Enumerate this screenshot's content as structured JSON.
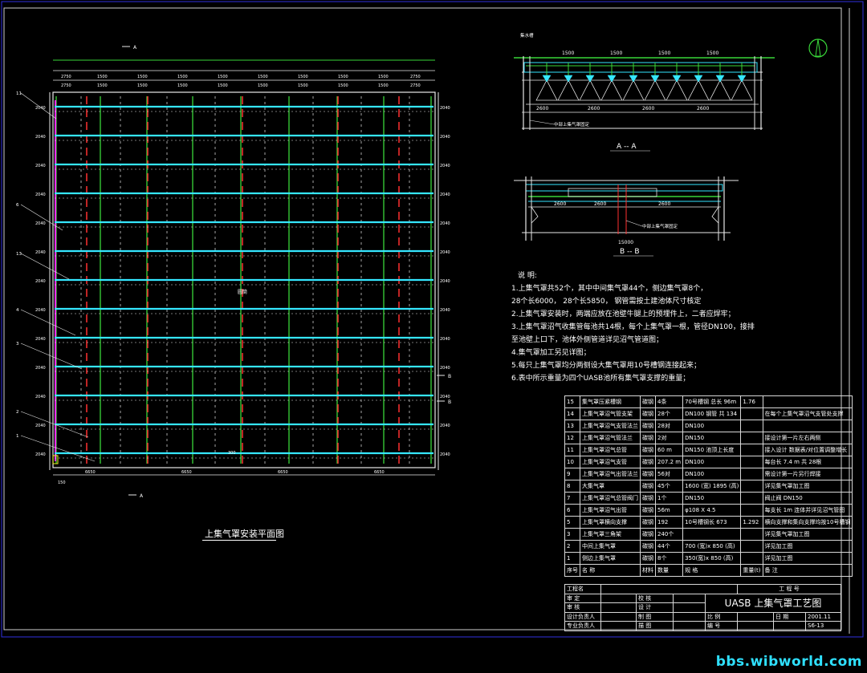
{
  "plan": {
    "title": "上集气罩安装平面图",
    "section_marks": [
      "A",
      "A",
      "B",
      "B"
    ],
    "top_dims": [
      "2750",
      "1500",
      "1500",
      "1500",
      "1500",
      "1500",
      "1500",
      "1500",
      "1500",
      "2750"
    ],
    "side_dims": [
      "2040",
      "2040",
      "2040",
      "2040",
      "2040",
      "2040",
      "2040",
      "2040",
      "2040",
      "2040",
      "2040",
      "2040",
      "2040"
    ],
    "bottom_dims": [
      "6650",
      "6650",
      "6650",
      "6650"
    ],
    "callouts": [
      "11",
      "6",
      "13",
      "4",
      "3",
      "2",
      "1"
    ],
    "label_mid": "圆筒",
    "label_dim": "300",
    "corner_label": "150"
  },
  "section_aa": {
    "title": "A -- A",
    "labels": [
      "集水槽",
      "中部上集气罩固定"
    ]
  },
  "section_bb": {
    "title": "B -- B",
    "labels": [
      "中部上集气罩固定"
    ]
  },
  "notes": {
    "heading": "说    明:",
    "lines": [
      "1.上集气罩共52个，其中中间集气罩44个，侧边集气罩8个，",
      "  28个长6000，  28个长5850，  钢管需按土建池体尺寸核定",
      "2.上集气罩安装时，两端应放在池壁牛腿上的预埋件上，二者应焊牢；",
      "3.上集气罩沼气收集管每池共14根，每个上集气罩一根，管径DN100，接排",
      "  至池壁上口下，池体外侧管道详见沼气管道图；",
      "4.集气罩加工另见详图；",
      "5.每只上集气罩均分两侧设大集气罩用10号槽钢连接起来；",
      "6.表中所示重量为四个UASB池所有集气罩支撑的重量；"
    ]
  },
  "bom": {
    "rows": [
      {
        "no": "15",
        "name": "集气罩压紧槽钢",
        "mat": "碳钢",
        "qty": "4条",
        "spec": "70号槽钢  总长 96m",
        "wt": "1.76",
        "note": ""
      },
      {
        "no": "14",
        "name": "上集气罩沼气管支架",
        "mat": "碳钢",
        "qty": "28个",
        "spec": "DN100 钢管  共 134",
        "wt": "",
        "note": "在每个上集气罩沼气支管处支撑"
      },
      {
        "no": "13",
        "name": "上集气罩沼气支管法兰",
        "mat": "碳钢",
        "qty": "28对",
        "spec": "DN100",
        "wt": "",
        "note": ""
      },
      {
        "no": "12",
        "name": "上集气罩沼气管法兰",
        "mat": "碳钢",
        "qty": "2对",
        "spec": "DN150",
        "wt": "",
        "note": "接设计第一片左右两侧"
      },
      {
        "no": "11",
        "name": "上集气罩沼气总管",
        "mat": "碳钢",
        "qty": "60 m",
        "spec": "DN150 池顶上长度",
        "wt": "",
        "note": "接入设计 数据表/对位置调整增长"
      },
      {
        "no": "10",
        "name": "上集气罩沼气支管",
        "mat": "碳钢",
        "qty": "207.2 m",
        "spec": "DN100",
        "wt": "",
        "note": "每台长 7.4 m 共 28根"
      },
      {
        "no": "9",
        "name": "上集气罩沼气出管法兰",
        "mat": "碳钢",
        "qty": "56对",
        "spec": "DN100",
        "wt": "",
        "note": "需设计第一片另行焊接"
      },
      {
        "no": "8",
        "name": "大集气罩",
        "mat": "碳钢",
        "qty": "45个",
        "spec": "1600 (宽) 1895 (高)",
        "wt": "",
        "note": "详见集气罩加工图"
      },
      {
        "no": "7",
        "name": "上集气罩沼气总管阀门",
        "mat": "碳钢",
        "qty": "1个",
        "spec": "DN150",
        "wt": "",
        "note": "阀止阀 DN150"
      },
      {
        "no": "6",
        "name": "上集气罩沼气出管",
        "mat": "碳钢",
        "qty": "56m",
        "spec": "φ108 X 4.5",
        "wt": "",
        "note": "每支长 1m  连体并详见沼气管图"
      },
      {
        "no": "5",
        "name": "上集气罩横向支撑",
        "mat": "碳钢",
        "qty": "192",
        "spec": "10号槽钢长 673",
        "wt": "1.292",
        "note": "横向支撑和集向支撑均按10号槽钢"
      },
      {
        "no": "3",
        "name": "上集气罩三角架",
        "mat": "碳钢",
        "qty": "240个",
        "spec": "",
        "wt": "",
        "note": "详见集气罩加工图"
      },
      {
        "no": "2",
        "name": "中间上集气罩",
        "mat": "碳钢",
        "qty": "44个",
        "spec": "700 (宽)x 850 (高)",
        "wt": "",
        "note": "详见加工图"
      },
      {
        "no": "1",
        "name": "侧边上集气罩",
        "mat": "碳钢",
        "qty": "8个",
        "spec": "350(宽)x 850 (高)",
        "wt": "",
        "note": "详见加工图"
      }
    ],
    "header": {
      "no": "序号",
      "name": "名    称",
      "mat": "材料",
      "qty": "数量",
      "spec": "规    格",
      "wt": "重量(t)",
      "note": "备    注"
    }
  },
  "titleblock": {
    "project_label": "工程名",
    "project_no_label": "工 程 号",
    "drawing_title": "UASB 上集气罩工艺图",
    "rows": [
      [
        "审    定",
        "",
        "校    核",
        ""
      ],
      [
        "审    核",
        "",
        "设    计",
        ""
      ],
      [
        "设计负责人",
        "",
        "制    图",
        ""
      ],
      [
        "专业负责人",
        "",
        "描    图",
        ""
      ]
    ],
    "scale_label": "比    例",
    "date_label": "日    期",
    "date_value": "2001.11",
    "sheet_label": "编    号",
    "sheet_value": "S6-13"
  },
  "watermark": "bbs.wibworld.com",
  "colors": {
    "green": "#39d639",
    "cyan": "#35e6ff",
    "magenta": "#ff2bff",
    "red": "#ff3030",
    "white": "#e8e8e8",
    "yellow": "#f0f020",
    "blue_border": "#3a3aff"
  }
}
